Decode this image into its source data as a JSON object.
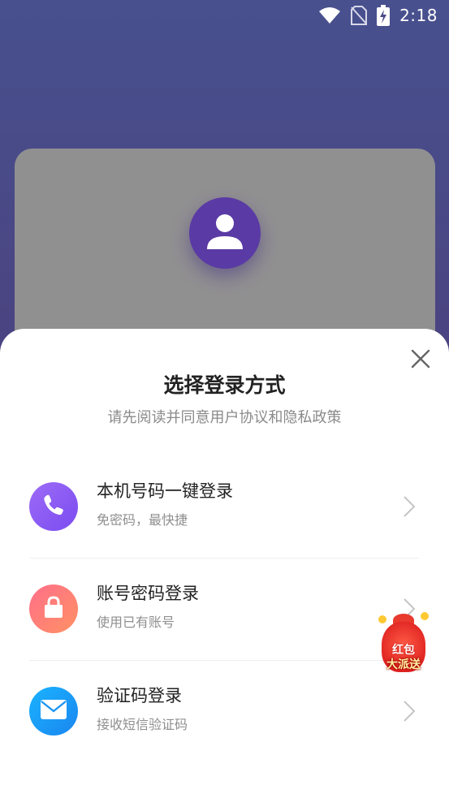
{
  "status_bar": {
    "time": "2:18",
    "icons": [
      "wifi-icon",
      "no-sim-icon",
      "battery-charging-icon"
    ]
  },
  "background": {
    "avatar_icon": "person-icon"
  },
  "sheet": {
    "title": "选择登录方式",
    "subtitle": "请先阅读并同意用户协议和隐私政策",
    "close_icon": "close-icon",
    "options": [
      {
        "label": "本机号码一键登录",
        "description": "免密码，最快捷",
        "icon": "phone-icon",
        "color": "#8b5cf6"
      },
      {
        "label": "账号密码登录",
        "description": "使用已有账号",
        "icon": "lock-icon",
        "color": "#ff7a7a"
      },
      {
        "label": "验证码登录",
        "description": "接收短信验证码",
        "icon": "mail-icon",
        "color": "#1ea0f5"
      }
    ]
  },
  "red_packet": {
    "line1": "红包",
    "line2": "大派送"
  }
}
